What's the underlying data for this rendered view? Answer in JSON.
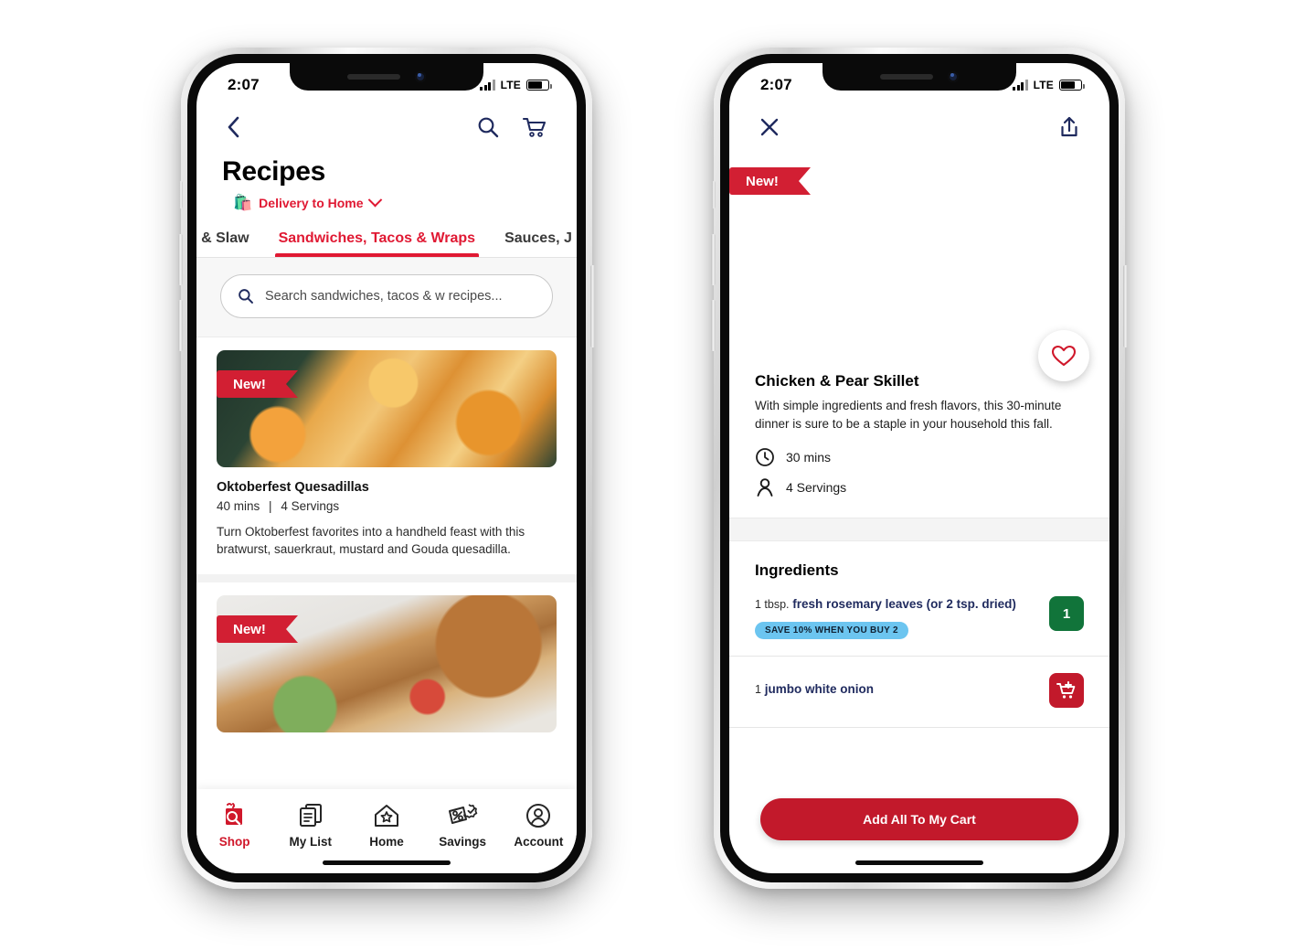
{
  "status_bar": {
    "time": "2:07",
    "network": "LTE"
  },
  "left_phone": {
    "header": {
      "back_icon": "chevron-left-icon",
      "search_icon": "search-icon",
      "cart_icon": "cart-icon"
    },
    "page_title": "Recipes",
    "delivery": {
      "icon": "grocery-bag-icon",
      "label": "Delivery to Home",
      "chevron": "chevron-down-icon"
    },
    "tabs": [
      {
        "label": "ad & Slaw",
        "active": false
      },
      {
        "label": "Sandwiches, Tacos & Wraps",
        "active": true
      },
      {
        "label": "Sauces, J",
        "active": false
      }
    ],
    "search": {
      "placeholder": "Search sandwiches, tacos & w recipes...",
      "icon": "search-icon"
    },
    "recipes": [
      {
        "badge": "New!",
        "title": "Oktoberfest Quesadillas",
        "time": "40 mins",
        "separator": "|",
        "servings": "4 Servings",
        "description": "Turn Oktoberfest favorites into a handheld feast with this bratwurst, sauerkraut, mustard and Gouda quesadilla.",
        "image_alt": "quesadilla-photo"
      },
      {
        "badge": "New!",
        "image_alt": "chicken-salad-sandwich-photo"
      }
    ],
    "bottom_nav": [
      {
        "label": "Shop",
        "icon": "shop-magnifier-icon",
        "active": true
      },
      {
        "label": "My List",
        "icon": "list-pages-icon",
        "active": false
      },
      {
        "label": "Home",
        "icon": "home-star-icon",
        "active": false
      },
      {
        "label": "Savings",
        "icon": "percent-tag-icon",
        "active": false
      },
      {
        "label": "Account",
        "icon": "person-circle-icon",
        "active": false
      }
    ]
  },
  "right_phone": {
    "header": {
      "close_icon": "close-x-icon",
      "share_icon": "share-upload-icon"
    },
    "hero": {
      "badge": "New!",
      "image_alt": "chicken-pear-skillet-photo",
      "favorite_icon": "heart-outline-icon"
    },
    "detail": {
      "title": "Chicken & Pear Skillet",
      "description": "With simple ingredients and fresh flavors, this 30-minute dinner is sure to be a staple in your household this fall.",
      "stats": [
        {
          "icon": "clock-icon",
          "value": "30 mins"
        },
        {
          "icon": "person-icon",
          "value": "4 Servings"
        }
      ]
    },
    "ingredients_heading": "Ingredients",
    "ingredients": [
      {
        "quantity": "1 tbsp.",
        "name": "fresh rosemary leaves (or 2 tsp. dried)",
        "promo": "SAVE 10% WHEN YOU BUY 2",
        "action": {
          "type": "quantity",
          "value": "1",
          "icon": "quantity-badge"
        }
      },
      {
        "quantity": "1",
        "name": "jumbo white onion",
        "promo": null,
        "action": {
          "type": "add",
          "value": "",
          "icon": "add-to-cart-icon"
        }
      }
    ],
    "cta_label": "Add All To My Cart"
  },
  "colors": {
    "brand_red": "#d21f33",
    "cta_red": "#c2192b",
    "navy": "#1f2a5e",
    "green": "#11743a",
    "promo_blue": "#6cc5f0"
  }
}
